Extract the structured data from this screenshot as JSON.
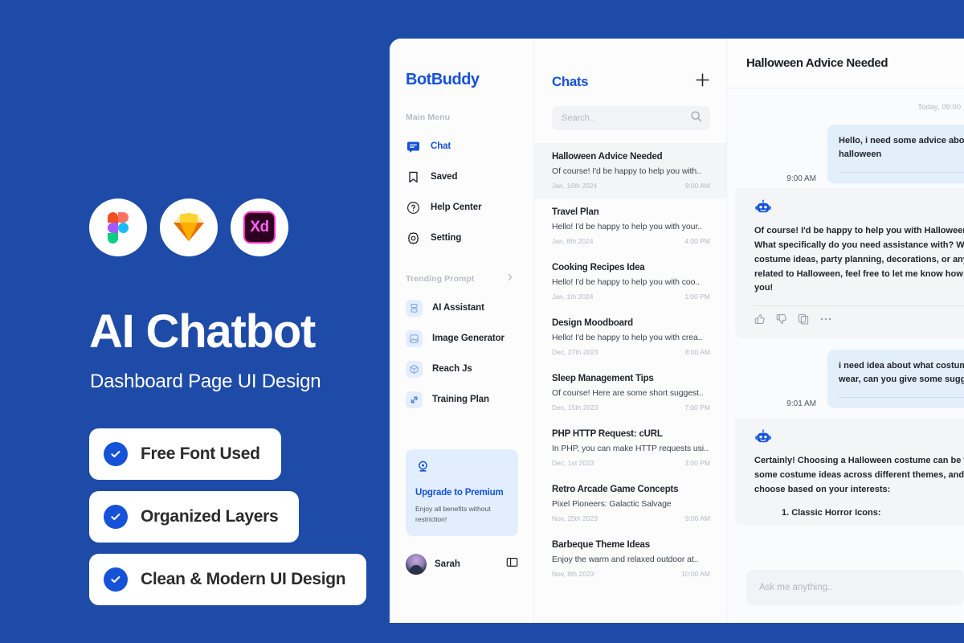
{
  "promo": {
    "title": "AI Chatbot",
    "subtitle": "Dashboard Page UI Design",
    "tools": [
      {
        "name": "figma-logo",
        "label": "Figma"
      },
      {
        "name": "sketch-logo",
        "label": "Sketch"
      },
      {
        "name": "adobe-xd-logo",
        "label": "Xd"
      }
    ],
    "badges": [
      {
        "label": "Free Font Used"
      },
      {
        "label": "Organized Layers"
      },
      {
        "label": "Clean & Modern UI Design"
      }
    ],
    "background_color": "#1F4BA8",
    "accent_color": "#1552D8"
  },
  "sidebar": {
    "brand": "BotBuddy",
    "main_menu_label": "Main Menu",
    "items": [
      {
        "label": "Chat",
        "icon": "chat-icon",
        "active": true
      },
      {
        "label": "Saved",
        "icon": "bookmark-icon",
        "active": false
      },
      {
        "label": "Help Center",
        "icon": "question-circle-icon",
        "active": false
      },
      {
        "label": "Setting",
        "icon": "gear-icon",
        "active": false
      }
    ],
    "trending_label": "Trending Prompt",
    "trending": [
      {
        "label": "AI Assistant",
        "icon": "assistant-icon"
      },
      {
        "label": "Image Generator",
        "icon": "image-icon"
      },
      {
        "label": "Reach Js",
        "icon": "cube-icon"
      },
      {
        "label": "Training Plan",
        "icon": "arrow-diagonal-icon"
      }
    ],
    "upgrade": {
      "icon": "award-icon",
      "title": "Upgrade to Premium",
      "description": "Enjoy all benefits without restriction!"
    },
    "user": {
      "name": "Sarah",
      "avatar": "user-avatar",
      "panel_toggle": "sidebar-toggle-icon"
    }
  },
  "chatlist": {
    "title": "Chats",
    "new_chat_icon": "plus-icon",
    "search": {
      "placeholder": "Search..",
      "value": "",
      "icon": "search-icon"
    },
    "items": [
      {
        "name": "Halloween Advice Needed",
        "snippet": "Of course! I'd be happy to help you with..",
        "date": "Jan, 16th 2024",
        "time": "9:00 AM",
        "active": true
      },
      {
        "name": "Travel Plan",
        "snippet": "Hello! I'd be happy to help you with your..",
        "date": "Jan, 8th 2024",
        "time": "4:00 PM",
        "active": false
      },
      {
        "name": "Cooking Recipes Idea",
        "snippet": "Hello! I'd be happy to help you with coo..",
        "date": "Jan, 1th 2024",
        "time": "1:00 PM",
        "active": false
      },
      {
        "name": "Design Moodboard",
        "snippet": "Hello! I'd be happy to help you with crea..",
        "date": "Dec, 27th 2023",
        "time": "8:00 AM",
        "active": false
      },
      {
        "name": "Sleep Management Tips",
        "snippet": "Of course! Here are some short suggest..",
        "date": "Dec, 15th 2023",
        "time": "7:00 PM",
        "active": false
      },
      {
        "name": "PHP HTTP Request: cURL",
        "snippet": "In PHP, you can make HTTP requests usi..",
        "date": "Dec, 1st 2023",
        "time": "3:00 PM",
        "active": false
      },
      {
        "name": "Retro Arcade Game Concepts",
        "snippet": "Pixel Pioneers: Galactic Salvage",
        "date": "Nov, 25th 2023",
        "time": "9:00 AM",
        "active": false
      },
      {
        "name": "Barbeque Theme Ideas",
        "snippet": "Enjoy the warm and relaxed outdoor at..",
        "date": "Nov, 8th 2023",
        "time": "10:00 AM",
        "active": false
      }
    ]
  },
  "conversation": {
    "title": "Halloween Advice Needed",
    "daystamp": "Today, 09:00",
    "messages": [
      {
        "role": "user",
        "text": "Hello, i need some advice about halloween",
        "time": "9:00 AM"
      },
      {
        "role": "bot",
        "avatar": "bot-avatar-icon",
        "text": "Of course! I'd be happy to help you with Halloween advice. What specifically do you need assistance with? Whether it's costume ideas, party planning, decorations, or anything else related to Halloween, feel free to let me know how I can assist you!",
        "actions": [
          "thumbs-up-icon",
          "thumbs-down-icon",
          "copy-icon",
          "more-icon"
        ]
      },
      {
        "role": "user",
        "text": "i need idea about what costume i should wear, can you give some suggestion?",
        "time": "9:01 AM"
      },
      {
        "role": "bot",
        "avatar": "bot-avatar-icon",
        "text": "Certainly! Choosing a Halloween costume can be fun. Here are some costume ideas across different themes, and you can choose based on your interests:",
        "list_item": "1. Classic Horror Icons:"
      }
    ],
    "composer": {
      "placeholder": "Ask me anything..",
      "value": ""
    }
  }
}
